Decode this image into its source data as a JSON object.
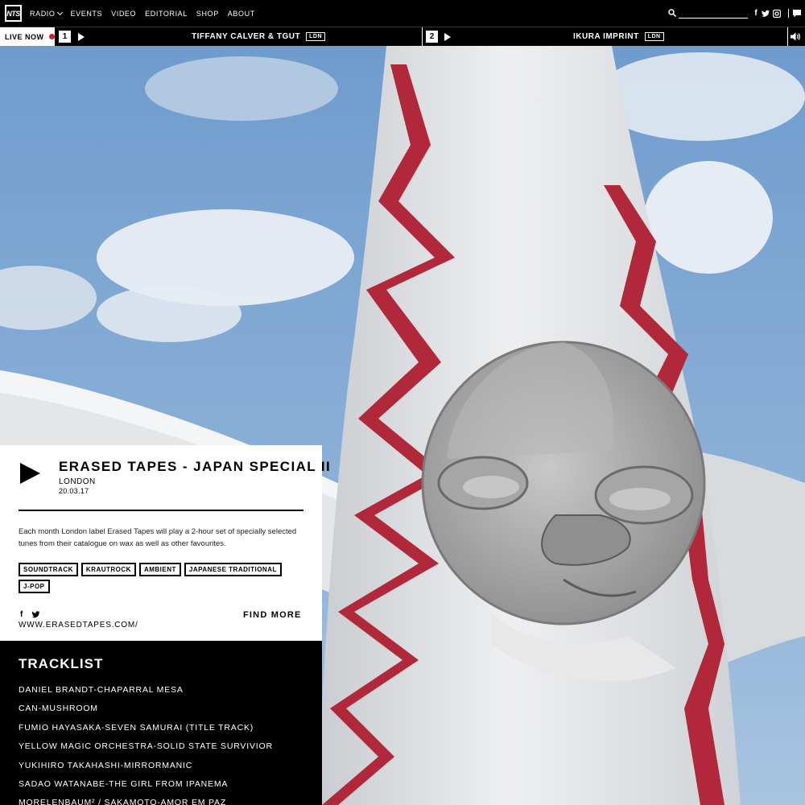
{
  "nav": {
    "logo": "NTS",
    "links": [
      {
        "label": "RADIO",
        "dropdown": true
      },
      {
        "label": "EVENTS"
      },
      {
        "label": "VIDEO"
      },
      {
        "label": "EDITORIAL"
      },
      {
        "label": "SHOP"
      },
      {
        "label": "ABOUT"
      }
    ],
    "search_placeholder": "",
    "social": [
      "facebook-icon",
      "twitter-icon",
      "instagram-icon",
      "chat-icon"
    ]
  },
  "live": {
    "label": "LIVE NOW",
    "indicator_color": "#e0162b",
    "channels": [
      {
        "number": "1",
        "title": "TIFFANY CALVER & TGUT",
        "location": "LDN"
      },
      {
        "number": "2",
        "title": "IKURA IMPRINT",
        "location": "LDN"
      }
    ]
  },
  "episode": {
    "title": "ERASED TAPES - JAPAN SPECIAL II",
    "location": "LONDON",
    "date": "20.03.17",
    "description": "Each month London label Erased Tapes will play a 2-hour set of specially selected tunes from their catalogue on wax as well as other favourites.",
    "tags": [
      "SOUNDTRACK",
      "KRAUTROCK",
      "AMBIENT",
      "JAPANESE TRADITIONAL",
      "J-POP"
    ],
    "website": "WWW.ERASEDTAPES.COM/",
    "find_more": "FIND MORE"
  },
  "tracklist": {
    "heading": "TRACKLIST",
    "tracks": [
      "DANIEL BRANDT-CHAPARRAL MESA",
      "CAN-MUSHROOM",
      "FUMIO HAYASAKA-SEVEN SAMURAI (TITLE TRACK)",
      "YELLOW MAGIC ORCHESTRA-SOLID STATE SURVIVIOR",
      "YUKIHIRO TAKAHASHI-MIRRORMANIC",
      "SADAO WATANABE-THE GIRL FROM IPANEMA",
      "MORELENBAUM² / SAKAMOTO-AMOR EM PAZ"
    ]
  },
  "colors": {
    "background": "#000000",
    "accent_live": "#e0162b",
    "sky": "#7ca3d0",
    "statue_red": "#b0283a"
  }
}
